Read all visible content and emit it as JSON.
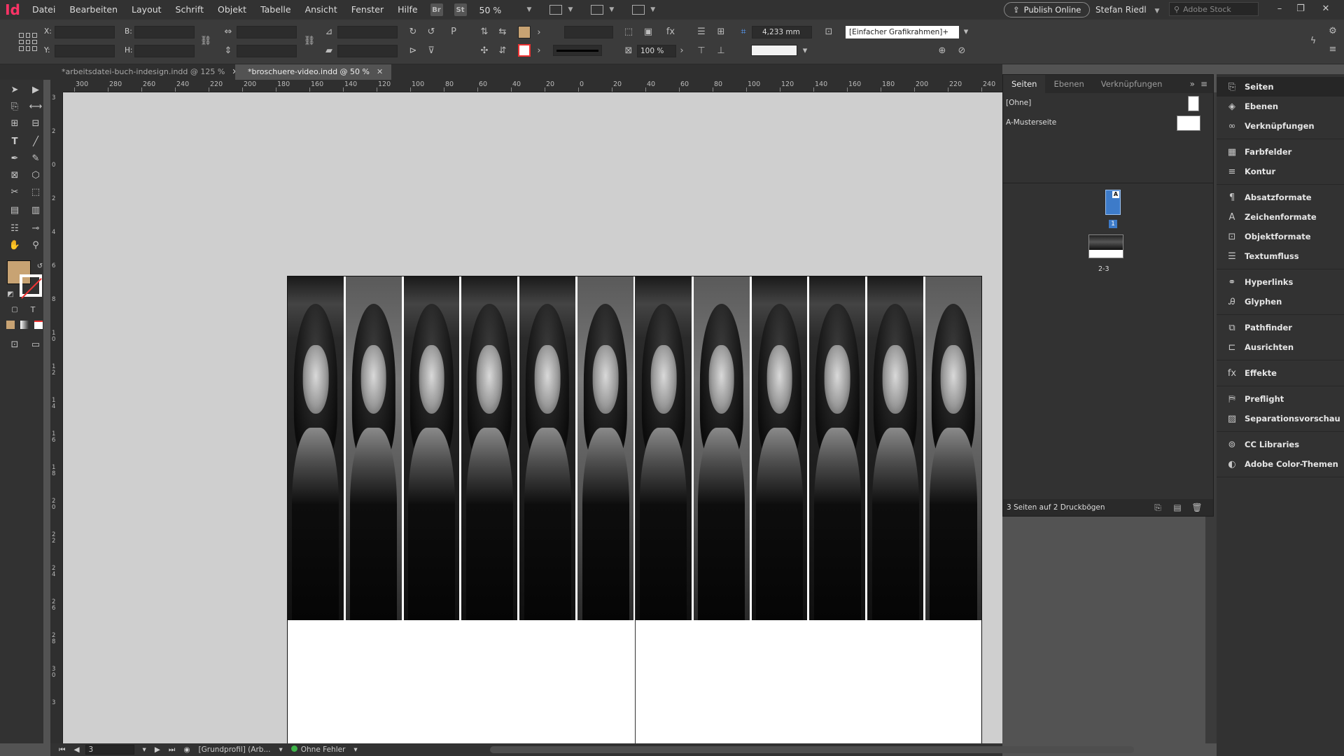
{
  "app": {
    "logo": "Id",
    "menu": [
      "Datei",
      "Bearbeiten",
      "Layout",
      "Schrift",
      "Objekt",
      "Tabelle",
      "Ansicht",
      "Fenster",
      "Hilfe"
    ],
    "bridge_badge": "Br",
    "stock_badge": "St",
    "zoom": "50 %",
    "publish_label": "Publish Online",
    "user": "Stefan Riedl",
    "stock_search_placeholder": "Adobe Stock"
  },
  "control_bar": {
    "x_label": "X:",
    "y_label": "Y:",
    "w_label": "B:",
    "h_label": "H:",
    "stroke_weight": "4,233 mm",
    "scale": "100 %",
    "object_style": "[Einfacher Grafikrahmen]+"
  },
  "tabs": [
    {
      "label": "*arbeitsdatei-buch-indesign.indd @ 125 %",
      "active": false
    },
    {
      "label": "*broschuere-video.indd @ 50 %",
      "active": true
    }
  ],
  "ruler_h": [
    "300",
    "280",
    "260",
    "240",
    "220",
    "200",
    "180",
    "160",
    "140",
    "120",
    "100",
    "80",
    "60",
    "40",
    "20",
    "0",
    "20",
    "40",
    "60",
    "80",
    "100",
    "120",
    "140",
    "160",
    "180",
    "200",
    "220",
    "240"
  ],
  "ruler_v": [
    "3",
    "2",
    "0",
    "2",
    "4",
    "6",
    "8",
    "10",
    "12",
    "14",
    "16",
    "18",
    "20",
    "22",
    "24",
    "26",
    "28",
    "30",
    "3"
  ],
  "pages_panel": {
    "tabs": [
      "Seiten",
      "Ebenen",
      "Verknüpfungen"
    ],
    "none_master": "[Ohne]",
    "a_master": "A-Musterseite",
    "page1_master_letter": "A",
    "page1_number": "1",
    "spread_label": "2-3",
    "footer": "3 Seiten auf 2 Druckbögen"
  },
  "dock": [
    [
      "Seiten",
      "Ebenen",
      "Verknüpfungen"
    ],
    [
      "Farbfelder",
      "Kontur"
    ],
    [
      "Absatzformate",
      "Zeichenformate",
      "Objektformate",
      "Textumfluss"
    ],
    [
      "Hyperlinks",
      "Glyphen"
    ],
    [
      "Pathfinder",
      "Ausrichten"
    ],
    [
      "Effekte"
    ],
    [
      "Preflight",
      "Separationsvorschau"
    ],
    [
      "CC Libraries",
      "Adobe Color-Themen"
    ]
  ],
  "status_bar": {
    "page": "3",
    "profile": "[Grundprofil] (Arb...",
    "preflight": "Ohne Fehler"
  },
  "colors": {
    "fill": "#c8a373",
    "accent": "#3d7bc9",
    "status_ok": "#3fb54a"
  }
}
